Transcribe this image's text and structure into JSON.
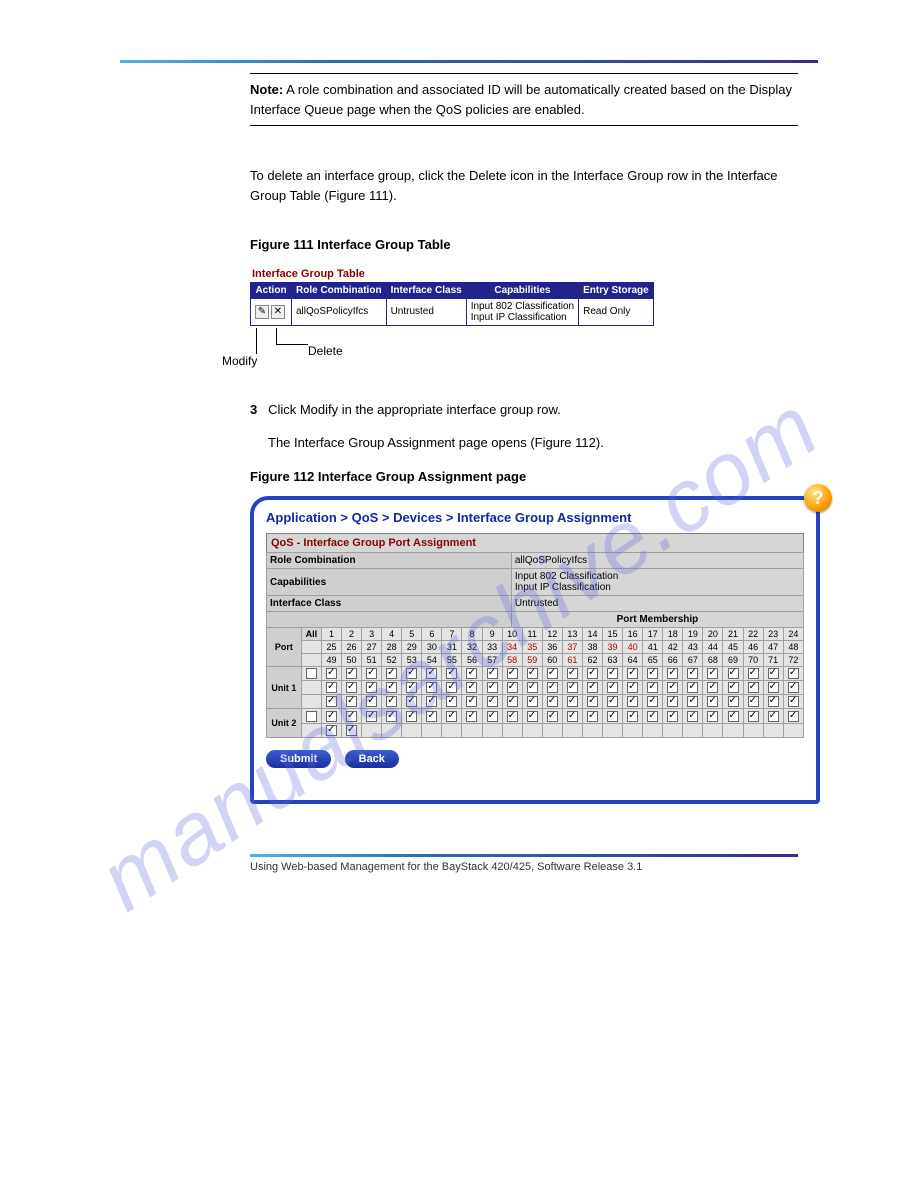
{
  "watermark": "manualsarchive.com",
  "note": {
    "label": "Note:",
    "text": "A role combination and associated ID will be automatically created based on the Display Interface Queue page when the QoS policies are enabled."
  },
  "para1": "To delete an interface group, click the Delete icon in the Interface Group row in the Interface Group Table (",
  "figref1": "Figure 111",
  "para1b": ").",
  "fig111": {
    "caption": "Figure 111   Interface Group Table",
    "title": "Interface Group Table",
    "headers": [
      "Action",
      "Role Combination",
      "Interface Class",
      "Capabilities",
      "Entry Storage"
    ],
    "row": {
      "role": "allQoSPolicyIfcs",
      "ifclass": "Untrusted",
      "caps1": "Input 802 Classification",
      "caps2": "Input IP Classification",
      "storage": "Read Only"
    },
    "callouts": {
      "modify": "Modify",
      "delete": "Delete"
    }
  },
  "step3": {
    "num": "3",
    "text": "Click Modify in the appropriate interface group row.",
    "text2a": "The Interface Group Assignment page opens (",
    "figref": "Figure 112",
    "text2b": ")."
  },
  "fig112": {
    "caption": "Figure 112   Interface Group Assignment page",
    "breadcrumb": "Application > QoS > Devices > Interface Group Assignment",
    "tableTitle": "QoS - Interface Group Port Assignment",
    "labels": {
      "role": "Role Combination",
      "caps": "Capabilities",
      "ifclass": "Interface Class",
      "port": "Port",
      "unit1": "Unit 1",
      "unit2": "Unit 2",
      "pm": "Port Membership",
      "all": "All"
    },
    "values": {
      "role": "allQoSPolicyIfcs",
      "caps1": "Input 802 Classification",
      "caps2": "Input IP Classification",
      "ifclass": "Untrusted"
    },
    "portRows": [
      [
        1,
        2,
        3,
        4,
        5,
        6,
        7,
        8,
        9,
        10,
        11,
        12,
        13,
        14,
        15,
        16,
        17,
        18,
        19,
        20,
        21,
        22,
        23,
        24
      ],
      [
        25,
        26,
        27,
        28,
        29,
        30,
        31,
        32,
        33,
        34,
        35,
        36,
        37,
        38,
        39,
        40,
        41,
        42,
        43,
        44,
        45,
        46,
        47,
        48
      ],
      [
        49,
        50,
        51,
        52,
        53,
        54,
        55,
        56,
        57,
        58,
        59,
        60,
        61,
        62,
        63,
        64,
        65,
        66,
        67,
        68,
        69,
        70,
        71,
        72
      ]
    ],
    "buttons": {
      "submit": "Submit",
      "back": "Back"
    }
  },
  "footer": "Using Web-based Management for the BayStack 420/425, Software Release 3.1"
}
